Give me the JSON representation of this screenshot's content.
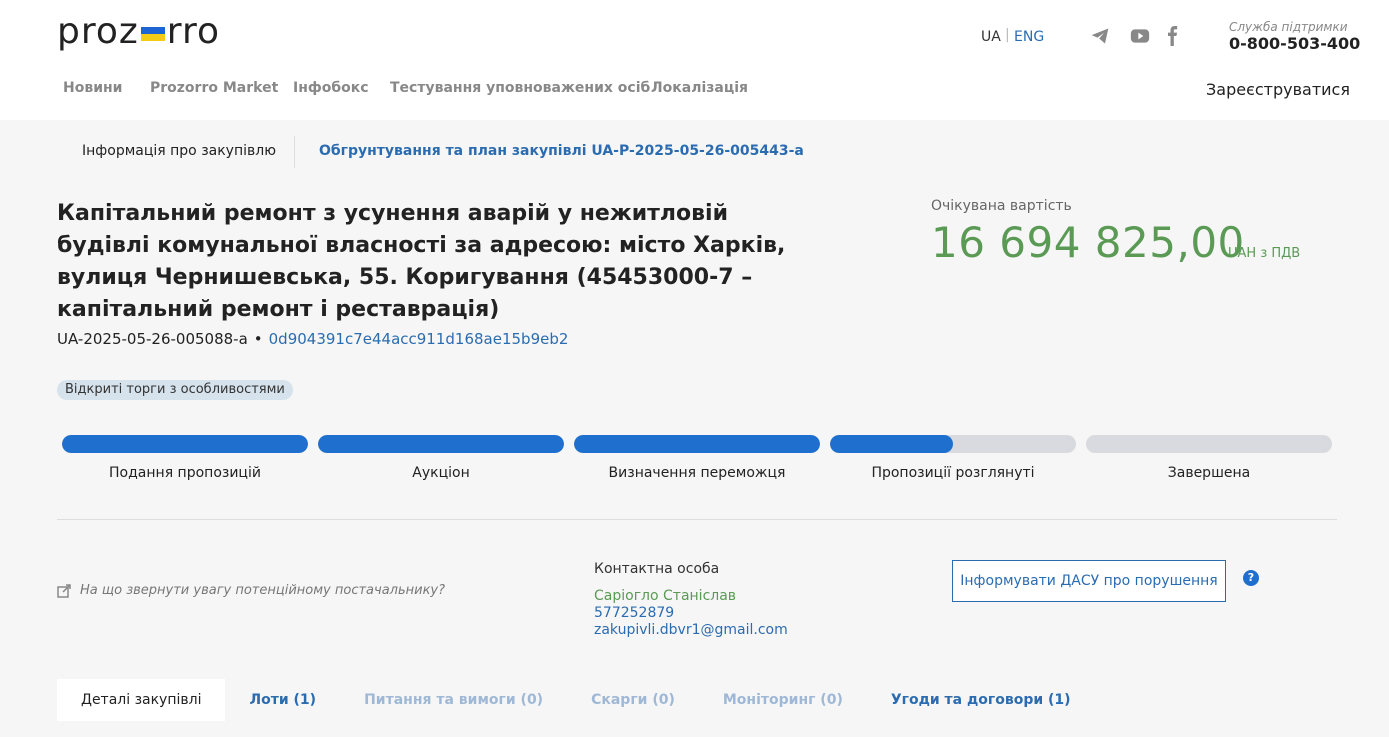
{
  "header": {
    "logo_left": "proz",
    "logo_right": "rro",
    "lang_ua": "UA",
    "lang_sep": "|",
    "lang_eng": "ENG",
    "support_label": "Служба підтримки",
    "support_phone": "0-800-503-400",
    "register": "Зареєструватися",
    "nav": [
      "Новини",
      "Prozorro Market",
      "Інфобокс",
      "Тестування уповноважених осіб",
      "Локалізація"
    ]
  },
  "breadcrumb": {
    "active": "Інформація про закупівлю",
    "link": "Обгрунтування та план закупівлі UA-P-2025-05-26-005443-a"
  },
  "tender": {
    "title": "Капітальний ремонт з усунення аварій у нежитловій будівлі комунальної власності за адресою: місто Харків, вулиця Чернишевська, 55. Коригування (45453000-7 – капітальний ремонт і реставрація)",
    "id": "UA-2025-05-26-005088-a",
    "dot": "•",
    "hash": "0d904391c7e44acc911d168ae15b9eb2",
    "badge": "Відкриті торги з особливостями",
    "cost_label": "Очікувана вартість",
    "cost_amount": "16 694 825,00",
    "cost_currency": "UAH з ПДВ"
  },
  "stages": [
    {
      "label": "Подання пропозицій",
      "progress": 1.0
    },
    {
      "label": "Аукціон",
      "progress": 1.0
    },
    {
      "label": "Визначення переможця",
      "progress": 1.0
    },
    {
      "label": "Пропозиції розглянуті",
      "progress": 0.5
    },
    {
      "label": "Завершена",
      "progress": 0.0
    }
  ],
  "hint": "На що звернути увагу потенційному постачальнику?",
  "contact": {
    "title": "Контактна особа",
    "name": "Саріогло Станіслав",
    "phone": "577252879",
    "email": "zakupivli.dbvr1@gmail.com"
  },
  "report_button": "Інформувати ДАСУ про порушення",
  "help_symbol": "?",
  "tabs": [
    "Деталі закупівлі",
    "Лоти (1)",
    "Питання та вимоги (0)",
    "Скарги (0)",
    "Моніторинг (0)",
    "Угоди та договори (1)"
  ],
  "colors": {
    "accent": "#2b6cb0",
    "progress": "#1f6fce",
    "cost": "#5a9a55"
  }
}
